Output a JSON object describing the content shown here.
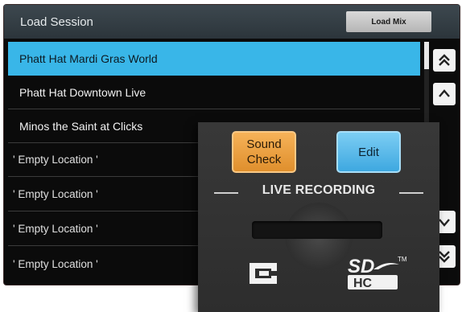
{
  "header": {
    "title": "Load Session",
    "load_mix_label": "Load Mix"
  },
  "sessions": [
    "Phatt Hat Mardi Gras World",
    "Phatt Hat Downtown Live",
    "Minos the Saint at Clicks",
    "' Empty Location '",
    "' Empty Location '",
    "' Empty Location '",
    "' Empty Location '"
  ],
  "selected_index": 0,
  "nav": {
    "top_icon": "double-chevron-up-icon",
    "up_icon": "chevron-up-icon",
    "down_icon": "chevron-down-icon",
    "bottom_icon": "double-chevron-down-icon"
  },
  "sd_panel": {
    "sound_check_label": "Sound Check",
    "edit_label": "Edit",
    "live_recording_label": "LIVE RECORDING",
    "logo_sd_text": "SD",
    "logo_hc_text": "HC",
    "trademark": "TM"
  },
  "colors": {
    "selected_row": "#39b6e8",
    "sound_check": "#f2a540",
    "edit": "#52b8ea"
  }
}
